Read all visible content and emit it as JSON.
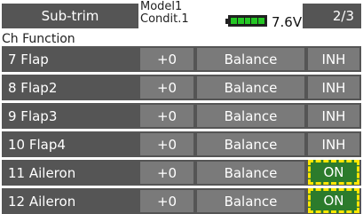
{
  "header": {
    "title": "Sub-trim",
    "model_line1": "Model1",
    "model_line2": "Condit.1",
    "battery_voltage": "7.6V",
    "page_indicator": "2/3"
  },
  "columns_label": "Ch Function",
  "rows": [
    {
      "label": " 7 Flap",
      "rate": "+0",
      "mode": "Balance",
      "switch": "INH"
    },
    {
      "label": " 8 Flap2",
      "rate": "+0",
      "mode": "Balance",
      "switch": "INH"
    },
    {
      "label": " 9 Flap3",
      "rate": "+0",
      "mode": "Balance",
      "switch": "INH"
    },
    {
      "label": "10 Flap4",
      "rate": "+0",
      "mode": "Balance",
      "switch": "INH"
    },
    {
      "label": "11 Aileron",
      "rate": "+0",
      "mode": "Balance",
      "switch": "ON"
    },
    {
      "label": "12 Aileron",
      "rate": "+0",
      "mode": "Balance",
      "switch": "ON"
    }
  ],
  "colors": {
    "button_bg": "#555555",
    "cell_bg": "#7a7a7a",
    "on_bg": "#2c7b2c",
    "highlight": "#ffe600",
    "battery": "#25c625"
  }
}
